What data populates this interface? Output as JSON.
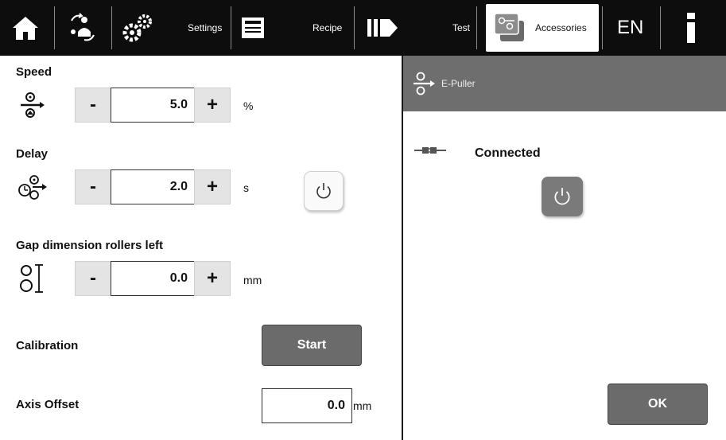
{
  "colors": {
    "topbar": "#0d0d0d",
    "panel_header": "#6e6e6e",
    "button_dark": "#6b6b6b",
    "stepper": "#e4e4e4"
  },
  "topbar": {
    "icons": [
      "home-icon",
      "operator-icon",
      "gears-icon",
      "recipe-icon",
      "test-icon",
      "accessories-icon",
      "info-icon"
    ],
    "settings_label": "Settings",
    "recipe_label": "Recipe",
    "test_label": "Test",
    "accessories_label": "Accessories",
    "language": "EN",
    "info_symbol": "i"
  },
  "speed": {
    "title": "Speed",
    "icon": "puller-speed-icon",
    "minus": "-",
    "value": "5.0",
    "plus": "+",
    "unit": "%"
  },
  "delay": {
    "title": "Delay",
    "icon": "delay-timer-icon",
    "minus": "-",
    "value": "2.0",
    "plus": "+",
    "unit": "s",
    "power_icon": "power-icon"
  },
  "gap": {
    "title": "Gap dimension rollers left",
    "icon": "rollers-gap-icon",
    "minus": "-",
    "value": "0.0",
    "plus": "+",
    "unit": "mm"
  },
  "calibration": {
    "title": "Calibration",
    "button": "Start"
  },
  "axis_offset": {
    "title": "Axis Offset",
    "value": "0.0",
    "unit": "mm"
  },
  "device": {
    "header_label": "E-Puller",
    "header_icon": "puller-icon",
    "connection_icon": "plug-icon",
    "status": "Connected",
    "power_icon": "power-icon",
    "ok_button": "OK"
  }
}
